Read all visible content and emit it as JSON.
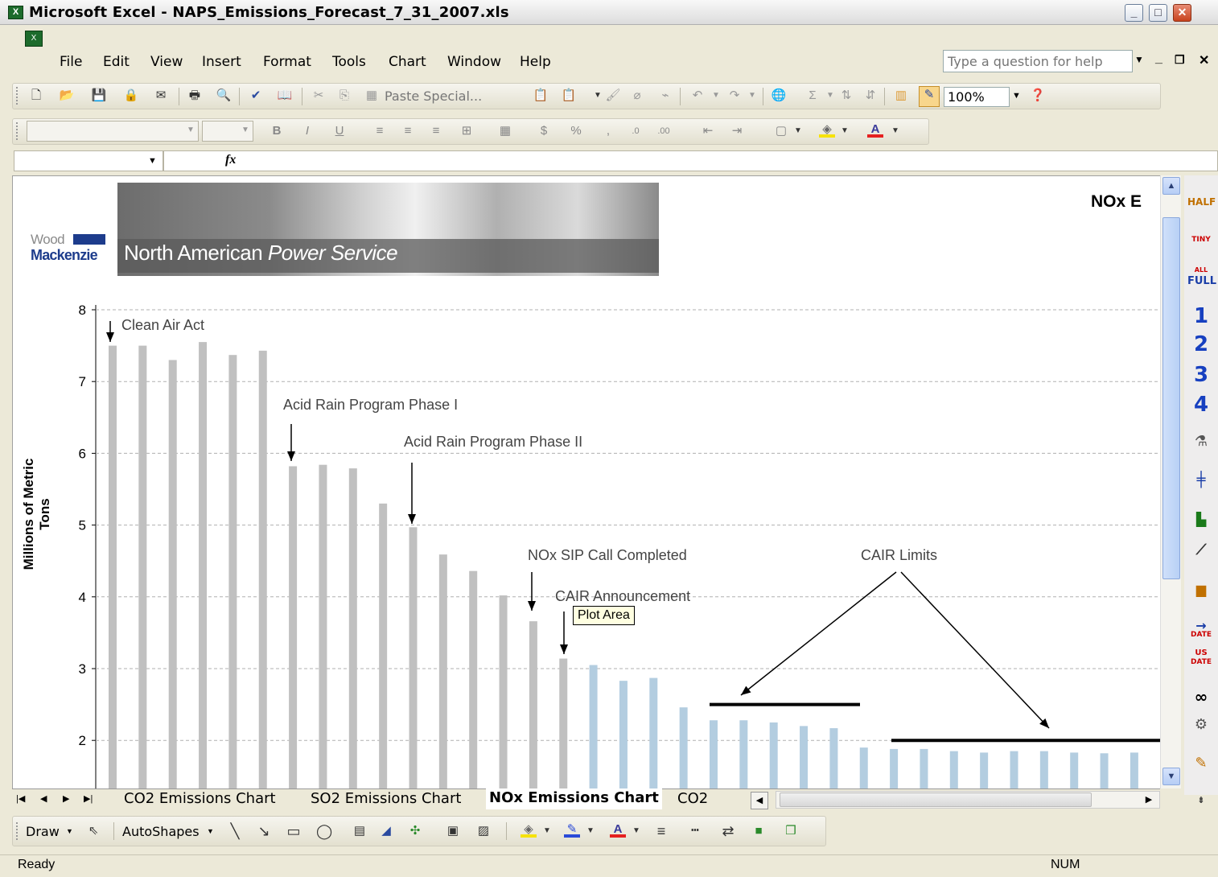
{
  "window": {
    "title": "Microsoft Excel - NAPS_Emissions_Forecast_7_31_2007.xls",
    "app_icon": "excel-icon"
  },
  "menu": {
    "items": [
      "File",
      "Edit",
      "View",
      "Insert",
      "Format",
      "Tools",
      "Chart",
      "Window",
      "Help"
    ],
    "help_placeholder": "Type a question for help",
    "min_glyph": "_",
    "restore_glyph": "❐",
    "close_glyph": "✕"
  },
  "toolbar": {
    "paste_special": "Paste Special...",
    "zoom": "100%"
  },
  "formula_bar": {
    "fx": "fx"
  },
  "banner": {
    "company_line1": "Wood",
    "company_line2": "Mackenzie",
    "service_plain": "North American ",
    "service_italic": "Power Service"
  },
  "chart": {
    "title": "NOx E",
    "ylabel": "Millions of Metric Tons",
    "tooltip": "Plot Area",
    "annotations": [
      "Clean Air Act",
      "Acid Rain  Program  Phase I",
      "Acid Rain  Program  Phase II",
      "NOx SIP Call Completed",
      "CAIR Announcement",
      "CAIR Limits"
    ]
  },
  "chart_data": {
    "type": "bar",
    "ylabel": "Millions of Metric Tons",
    "ylim": [
      0,
      8
    ],
    "yticks": [
      2,
      3,
      4,
      5,
      6,
      7,
      8
    ],
    "grid": "horizontal dashed",
    "series": [
      {
        "values": [
          7.5,
          7.5,
          7.3,
          7.55,
          7.37,
          7.43,
          null,
          null,
          null,
          null,
          null,
          null,
          null,
          null,
          null,
          null,
          null,
          null,
          null,
          null,
          null,
          null,
          null,
          null,
          null,
          null,
          null,
          null,
          null,
          null,
          null,
          null,
          null,
          null,
          null,
          null
        ],
        "color": "#c0c0c0"
      }
    ],
    "historical": [
      7.5,
      7.5,
      7.3,
      7.55,
      7.37,
      7.43,
      5.82,
      5.84,
      5.79,
      5.3,
      4.97,
      4.59,
      4.36,
      4.02,
      3.66,
      3.14
    ],
    "forecast": [
      3.05,
      2.83,
      2.87,
      2.46,
      2.28,
      2.28,
      2.25,
      2.2,
      2.17,
      1.9,
      1.88,
      1.88,
      1.85,
      1.83,
      1.85,
      1.85,
      1.83,
      1.82,
      1.83,
      1.85
    ],
    "historical_color": "#c0c0c0",
    "forecast_color": "#b3cde0",
    "cair_limit_lines": [
      2.5,
      2.0
    ]
  },
  "sheet_tabs": {
    "tabs": [
      "CO2 Emissions Chart",
      "SO2 Emissions Chart",
      "NOx Emissions Chart",
      "CO2"
    ],
    "active": "NOx Emissions Chart"
  },
  "draw_toolbar": {
    "draw": "Draw",
    "autoshapes": "AutoShapes"
  },
  "status": {
    "ready": "Ready",
    "num": "NUM"
  },
  "right_toolbar": {
    "half": "HALF",
    "tiny": "TINY",
    "full_top": "ALL",
    "full": "FULL",
    "n1": "1",
    "n2": "2",
    "n3": "3",
    "n4": "4",
    "date": "DATE",
    "us_date": "US",
    "us_date2": "DATE"
  }
}
